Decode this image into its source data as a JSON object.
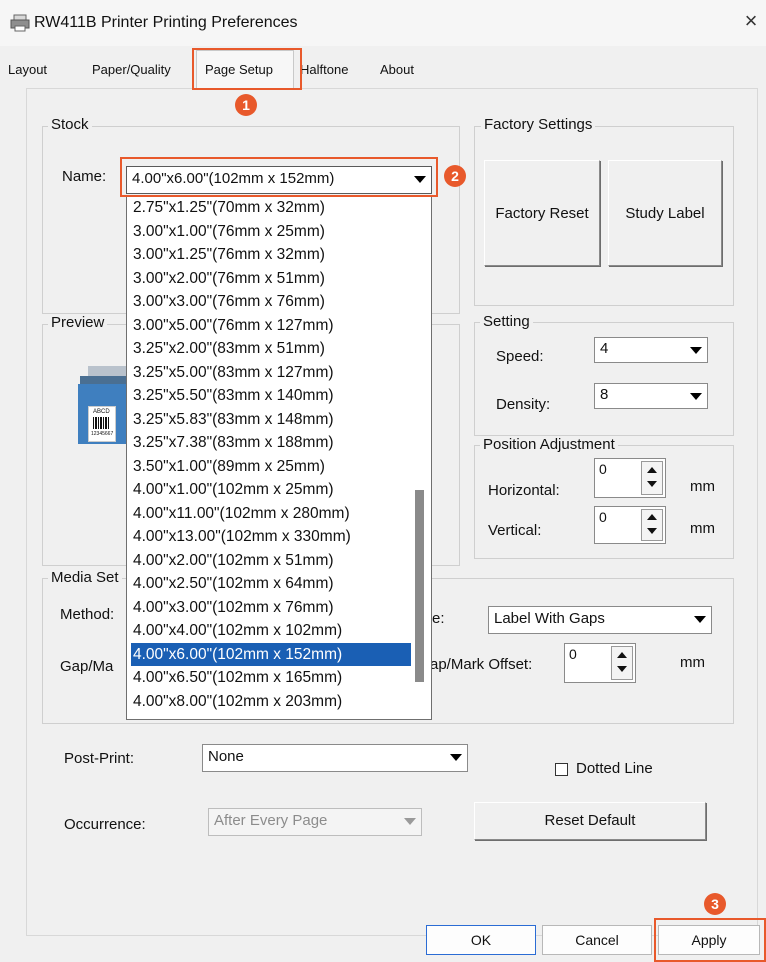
{
  "window": {
    "title": "RW411B Printer Printing Preferences",
    "close": "×"
  },
  "tabs": [
    {
      "label": "Layout"
    },
    {
      "label": "Paper/Quality"
    },
    {
      "label": "Page Setup"
    },
    {
      "label": "Halftone"
    },
    {
      "label": "About"
    }
  ],
  "active_tab": "Page Setup",
  "stock": {
    "group_label": "Stock",
    "name_label": "Name:",
    "name_value": "4.00\"x6.00\"(102mm x 152mm)",
    "options": [
      "2.75\"x1.25\"(70mm x 32mm)",
      "3.00\"x1.00\"(76mm x 25mm)",
      "3.00\"x1.25\"(76mm x 32mm)",
      "3.00\"x2.00\"(76mm x 51mm)",
      "3.00\"x3.00\"(76mm x 76mm)",
      "3.00\"x5.00\"(76mm x 127mm)",
      "3.25\"x2.00\"(83mm x 51mm)",
      "3.25\"x5.00\"(83mm x 127mm)",
      "3.25\"x5.50\"(83mm x 140mm)",
      "3.25\"x5.83\"(83mm x 148mm)",
      "3.25\"x7.38\"(83mm x 188mm)",
      "3.50\"x1.00\"(89mm x 25mm)",
      "4.00\"x1.00\"(102mm x 25mm)",
      "4.00\"x11.00\"(102mm x 280mm)",
      "4.00\"x13.00\"(102mm x 330mm)",
      "4.00\"x2.00\"(102mm x 51mm)",
      "4.00\"x2.50\"(102mm x 64mm)",
      "4.00\"x3.00\"(102mm x 76mm)",
      "4.00\"x4.00\"(102mm x 102mm)",
      "4.00\"x6.00\"(102mm x 152mm)",
      "4.00\"x6.50\"(102mm x 165mm)",
      "4.00\"x8.00\"(102mm x 203mm)"
    ],
    "selected_index": 19
  },
  "factory": {
    "group_label": "Factory Settings",
    "reset_label": "Factory Reset",
    "study_label": "Study Label"
  },
  "preview": {
    "group_label": "Preview",
    "label_text": "ABCD",
    "label_number": "12345667"
  },
  "setting": {
    "group_label": "Setting",
    "speed_label": "Speed:",
    "speed_value": "4",
    "density_label": "Density:",
    "density_value": "8"
  },
  "position": {
    "group_label": "Position Adjustment",
    "horizontal_label": "Horizontal:",
    "horizontal_value": "0",
    "vertical_label": "Vertical:",
    "vertical_value": "0",
    "unit": "mm"
  },
  "media": {
    "group_label": "Media Set",
    "method_label": "Method:",
    "type_label_fragment": "e:",
    "type_value": "Label With Gaps",
    "gap_label": "Gap/Ma",
    "offset_label": "ap/Mark Offset:",
    "offset_value": "0",
    "unit": "mm"
  },
  "post_print": {
    "label": "Post-Print:",
    "value": "None",
    "dotted_line_label": "Dotted Line",
    "occurrence_label": "Occurrence:",
    "occurrence_value": "After Every Page",
    "reset_default_label": "Reset Default"
  },
  "footer": {
    "ok": "OK",
    "cancel": "Cancel",
    "apply": "Apply"
  },
  "annotations": {
    "step1": "1",
    "step2": "2",
    "step3": "3"
  },
  "colors": {
    "annotation": "#e8592b",
    "selection": "#1a5fb4"
  }
}
